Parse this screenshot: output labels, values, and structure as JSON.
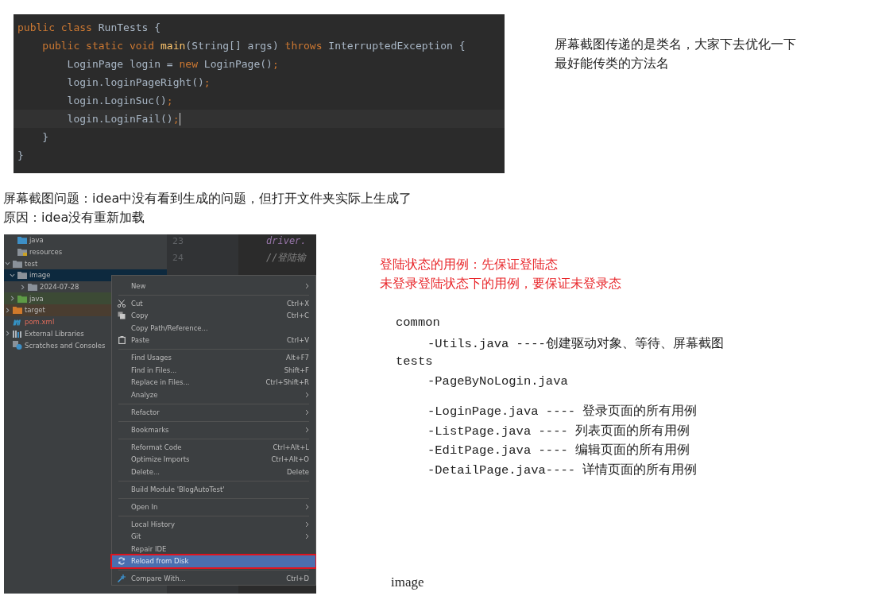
{
  "code_block": {
    "lines": [
      {
        "current": false,
        "tokens": [
          {
            "kind": "keyword",
            "text": "public class "
          },
          {
            "kind": "plain",
            "text": "RunTests {"
          }
        ]
      },
      {
        "current": false,
        "tokens": [
          {
            "kind": "keyword",
            "text": "    public static void "
          },
          {
            "kind": "method",
            "text": "main"
          },
          {
            "kind": "plain",
            "text": "(String[] args) "
          },
          {
            "kind": "keyword",
            "text": "throws "
          },
          {
            "kind": "plain",
            "text": "InterruptedException {"
          }
        ]
      },
      {
        "current": false,
        "tokens": [
          {
            "kind": "plain",
            "text": "        LoginPage login = "
          },
          {
            "kind": "keyword",
            "text": "new "
          },
          {
            "kind": "plain",
            "text": "LoginPage()"
          },
          {
            "kind": "keyword",
            "text": ";"
          }
        ]
      },
      {
        "current": false,
        "tokens": [
          {
            "kind": "plain",
            "text": "        login.loginPageRight()"
          },
          {
            "kind": "keyword",
            "text": ";"
          }
        ]
      },
      {
        "current": false,
        "tokens": [
          {
            "kind": "plain",
            "text": "        login.LoginSuc()"
          },
          {
            "kind": "keyword",
            "text": ";"
          }
        ]
      },
      {
        "current": true,
        "tokens": [
          {
            "kind": "plain",
            "text": "        login.LoginFail()"
          },
          {
            "kind": "keyword",
            "text": ";"
          }
        ]
      },
      {
        "current": false,
        "tokens": [
          {
            "kind": "plain",
            "text": "    }"
          }
        ]
      },
      {
        "current": false,
        "tokens": [
          {
            "kind": "plain",
            "text": "}"
          }
        ]
      }
    ]
  },
  "top_note": [
    "屏幕截图传递的是类名，大家下去优化一下",
    "最好能传类的方法名"
  ],
  "problem_notes": [
    "屏幕截图问题：idea中没有看到生成的问题，但打开文件夹实际上生成了",
    "原因：idea没有重新加载"
  ],
  "ide": {
    "tree": [
      {
        "children": [
          {
            "children": [
              {
                "children": [
                  {
                    "label": "java",
                    "kind": "source"
                  },
                  {
                    "label": "resources",
                    "kind": "resources"
                  }
                ]
              },
              {
                "label": "test",
                "kind": "folder",
                "expanded": true,
                "selected": false,
                "children": [
                  {
                    "label": "image",
                    "kind": "folder",
                    "expanded": true,
                    "selected": true,
                    "children": [
                      {
                        "label": "2024-07-28",
                        "kind": "folder",
                        "expanded": false,
                        "selected": false
                      }
                    ]
                  },
                  {
                    "label": "java",
                    "kind": "test-source",
                    "expanded": false,
                    "selected": false
                  }
                ]
              }
            ]
          },
          {
            "label": "target",
            "kind": "excluded",
            "expanded": false,
            "selected": false
          },
          {
            "label": "pom.xml",
            "kind": "maven-file"
          }
        ]
      },
      {
        "label": "External Libraries",
        "kind": "libraries",
        "expanded": false,
        "selected": false
      },
      {
        "label": "Scratches and Consoles",
        "kind": "scratches"
      }
    ],
    "editor_lines": [
      {
        "number": "23",
        "code": "driver."
      },
      {
        "number": "24",
        "code": "//登陆输"
      }
    ],
    "context_menu": [
      {
        "kind": "item",
        "label": "New",
        "submenu": true,
        "selected": false,
        "outlined": false
      },
      {
        "kind": "separator"
      },
      {
        "kind": "cut",
        "label": "Cut",
        "shortcut": "Ctrl+X",
        "submenu": false,
        "selected": false,
        "outlined": false
      },
      {
        "kind": "copy",
        "label": "Copy",
        "shortcut": "Ctrl+C",
        "submenu": false,
        "selected": false,
        "outlined": false
      },
      {
        "kind": "item",
        "label": "Copy Path/Reference...",
        "submenu": false,
        "selected": false,
        "outlined": false
      },
      {
        "kind": "paste",
        "label": "Paste",
        "shortcut": "Ctrl+V",
        "submenu": false,
        "selected": false,
        "outlined": false
      },
      {
        "kind": "separator"
      },
      {
        "kind": "item",
        "label": "Find Usages",
        "shortcut": "Alt+F7",
        "submenu": false,
        "selected": false,
        "outlined": false
      },
      {
        "kind": "item",
        "label": "Find in Files...",
        "shortcut": "Shift+F",
        "submenu": false,
        "selected": false,
        "outlined": false
      },
      {
        "kind": "item",
        "label": "Replace in Files...",
        "shortcut": "Ctrl+Shift+R",
        "submenu": false,
        "selected": false,
        "outlined": false
      },
      {
        "kind": "item",
        "label": "Analyze",
        "submenu": true,
        "selected": false,
        "outlined": false
      },
      {
        "kind": "separator"
      },
      {
        "kind": "item",
        "label": "Refactor",
        "submenu": true,
        "selected": false,
        "outlined": false
      },
      {
        "kind": "separator"
      },
      {
        "kind": "item",
        "label": "Bookmarks",
        "submenu": true,
        "selected": false,
        "outlined": false
      },
      {
        "kind": "separator"
      },
      {
        "kind": "item",
        "label": "Reformat Code",
        "shortcut": "Ctrl+Alt+L",
        "submenu": false,
        "selected": false,
        "outlined": false
      },
      {
        "kind": "item",
        "label": "Optimize Imports",
        "shortcut": "Ctrl+Alt+O",
        "submenu": false,
        "selected": false,
        "outlined": false
      },
      {
        "kind": "item",
        "label": "Delete...",
        "shortcut": "Delete",
        "submenu": false,
        "selected": false,
        "outlined": false
      },
      {
        "kind": "separator"
      },
      {
        "kind": "item",
        "label": "Build Module 'BlogAutoTest'",
        "submenu": false,
        "selected": false,
        "outlined": false
      },
      {
        "kind": "separator"
      },
      {
        "kind": "item",
        "label": "Open In",
        "submenu": true,
        "selected": false,
        "outlined": false
      },
      {
        "kind": "separator"
      },
      {
        "kind": "item",
        "label": "Local History",
        "submenu": true,
        "selected": false,
        "outlined": false
      },
      {
        "kind": "item",
        "label": "Git",
        "submenu": true,
        "selected": false,
        "outlined": false
      },
      {
        "kind": "item",
        "label": "Repair IDE",
        "submenu": false,
        "selected": false,
        "outlined": false
      },
      {
        "kind": "reload",
        "label": "Reload from Disk",
        "submenu": false,
        "selected": true,
        "outlined": true
      },
      {
        "kind": "separator"
      },
      {
        "kind": "compare",
        "label": "Compare With...",
        "shortcut": "Ctrl+D",
        "submenu": false,
        "selected": false,
        "outlined": false
      }
    ]
  },
  "red_notes": [
    "登陆状态的用例：先保证登陆态",
    "未登录登陆状态下的用例，要保证未登录态"
  ],
  "outline": [
    {
      "label": "common",
      "groups": [
        [
          {
            "label": "-Utils.java ----创建驱动对象、等待、屏幕截图"
          }
        ]
      ]
    },
    {
      "label": "tests",
      "groups": [
        [
          {
            "label": "-PageByNoLogin.java"
          }
        ],
        [
          {
            "label": "-LoginPage.java ---- 登录页面的所有用例"
          },
          {
            "label": "-ListPage.java  ---- 列表页面的所有用例"
          },
          {
            "label": "-EditPage.java  ---- 编辑页面的所有用例"
          },
          {
            "label": "-DetailPage.java---- 详情页面的所有用例"
          }
        ]
      ]
    }
  ],
  "caption": "image"
}
